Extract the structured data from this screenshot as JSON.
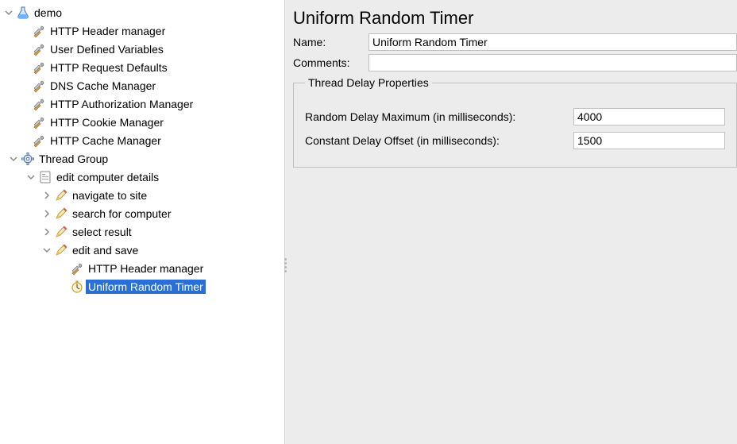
{
  "tree": {
    "root": "demo",
    "config_items": [
      "HTTP Header manager",
      "User Defined Variables",
      "HTTP Request Defaults",
      "DNS Cache Manager",
      "HTTP Authorization Manager",
      "HTTP Cookie Manager",
      "HTTP Cache Manager"
    ],
    "thread_group": "Thread Group",
    "tx": "edit computer details",
    "tx_children": [
      "navigate to site",
      "search for computer",
      "select result"
    ],
    "tx_edit": "edit and save",
    "tx_edit_children": {
      "header_mgr": "HTTP Header manager",
      "timer": "Uniform Random Timer"
    }
  },
  "detail": {
    "title": "Uniform Random Timer",
    "name_label": "Name:",
    "name_value": "Uniform Random Timer",
    "comments_label": "Comments:",
    "comments_value": "",
    "group_title": "Thread Delay Properties",
    "random_label": "Random Delay Maximum (in milliseconds):",
    "random_value": "4000",
    "constant_label": "Constant Delay Offset (in milliseconds):",
    "constant_value": "1500"
  }
}
